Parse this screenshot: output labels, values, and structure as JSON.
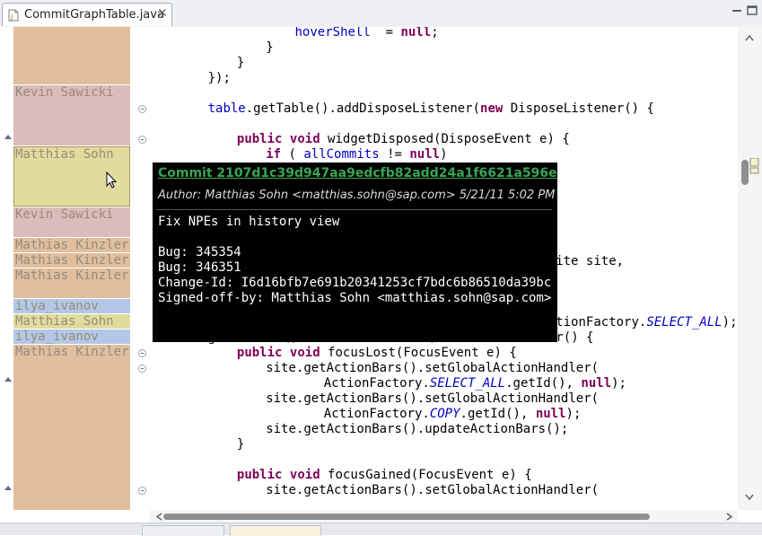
{
  "editor_tab": {
    "title": "CommitGraphTable.java",
    "icon": "java-file-icon",
    "close_icon": "close-icon"
  },
  "window_controls": {
    "minimize_icon": "minimize-icon",
    "maximize_icon": "maximize-icon"
  },
  "blame": {
    "authors": [
      "Kevin Sawicki",
      "Matthias Sohn",
      "Kevin Sawicki",
      "Mathias Kinzler",
      "Mathias Kinzler",
      "Mathias Kinzler",
      "ilya_ivanov",
      "Matthias Sohn",
      "ilya_ivanov",
      "Mathias Kinzler"
    ]
  },
  "code_lines": [
    {
      "indent": 5,
      "tokens": [
        [
          "fd",
          "hoverShell"
        ],
        [
          "",
          "  = "
        ],
        [
          "kw",
          "null"
        ],
        [
          "",
          ";"
        ]
      ]
    },
    {
      "indent": 4,
      "tokens": [
        [
          "",
          "}"
        ]
      ]
    },
    {
      "indent": 3,
      "tokens": [
        [
          "",
          "}"
        ]
      ]
    },
    {
      "indent": 2,
      "tokens": [
        [
          "",
          "});"
        ]
      ]
    },
    {
      "indent": 0,
      "tokens": []
    },
    {
      "indent": 2,
      "tokens": [
        [
          "fd",
          "table"
        ],
        [
          "",
          ".getTable().addDisposeListener("
        ],
        [
          "kw",
          "new"
        ],
        [
          "",
          " DisposeListener() {"
        ]
      ]
    },
    {
      "indent": 0,
      "tokens": []
    },
    {
      "indent": 3,
      "tokens": [
        [
          "kw",
          "public"
        ],
        [
          "",
          " "
        ],
        [
          "kw",
          "void"
        ],
        [
          "",
          " widgetDisposed(DisposeEvent e) {"
        ]
      ]
    },
    {
      "indent": 4,
      "tokens": [
        [
          "kw",
          "if"
        ],
        [
          "",
          " ( "
        ],
        [
          "fd",
          "allCommits"
        ],
        [
          "",
          " != "
        ],
        [
          "kw",
          "null"
        ],
        [
          "",
          ")"
        ]
      ]
    },
    {
      "indent": 0,
      "tokens": []
    },
    {
      "indent": 0,
      "tokens": []
    },
    {
      "indent": 0,
      "tokens": []
    },
    {
      "indent": 0,
      "tokens": []
    },
    {
      "indent": 0,
      "tokens": []
    },
    {
      "indent": 0,
      "tokens": []
    },
    {
      "indent": 14,
      "tokens": [
        [
          "",
          "ite site,"
        ]
      ]
    },
    {
      "indent": 0,
      "tokens": []
    },
    {
      "indent": 0,
      "tokens": []
    },
    {
      "indent": 0,
      "tokens": []
    },
    {
      "indent": 14,
      "tokens": [
        [
          "",
          "tionFactory."
        ],
        [
          "fdi",
          "SELECT_ALL"
        ],
        [
          "",
          ");"
        ]
      ]
    },
    {
      "indent": 2,
      "tokens": [
        [
          "",
          "getControl().addFocusListener("
        ],
        [
          "kw",
          "new"
        ],
        [
          "",
          " FocusListener() {"
        ]
      ]
    },
    {
      "indent": 3,
      "tokens": [
        [
          "kw",
          "public"
        ],
        [
          "",
          " "
        ],
        [
          "kw",
          "void"
        ],
        [
          "",
          " focusLost(FocusEvent e) {"
        ]
      ]
    },
    {
      "indent": 4,
      "tokens": [
        [
          "",
          "site.getActionBars().setGlobalActionHandler("
        ]
      ]
    },
    {
      "indent": 6,
      "tokens": [
        [
          "",
          "ActionFactory."
        ],
        [
          "fdi",
          "SELECT_ALL"
        ],
        [
          "",
          ".getId(), "
        ],
        [
          "kw",
          "null"
        ],
        [
          "",
          ");"
        ]
      ]
    },
    {
      "indent": 4,
      "tokens": [
        [
          "",
          "site.getActionBars().setGlobalActionHandler("
        ]
      ]
    },
    {
      "indent": 6,
      "tokens": [
        [
          "",
          "ActionFactory."
        ],
        [
          "fdi",
          "COPY"
        ],
        [
          "",
          ".getId(), "
        ],
        [
          "kw",
          "null"
        ],
        [
          "",
          ");"
        ]
      ]
    },
    {
      "indent": 4,
      "tokens": [
        [
          "",
          "site.getActionBars().updateActionBars();"
        ]
      ]
    },
    {
      "indent": 3,
      "tokens": [
        [
          "",
          "}"
        ]
      ]
    },
    {
      "indent": 0,
      "tokens": []
    },
    {
      "indent": 3,
      "tokens": [
        [
          "kw",
          "public"
        ],
        [
          "",
          " "
        ],
        [
          "kw",
          "void"
        ],
        [
          "",
          " focusGained(FocusEvent e) {"
        ]
      ]
    },
    {
      "indent": 4,
      "tokens": [
        [
          "",
          "site.getActionBars().setGlobalActionHandler("
        ]
      ]
    }
  ],
  "popup": {
    "title": "Commit 2107d1c39d947aa9edcfb82add24a1f6621a596e",
    "author": "Author: Matthias Sohn <matthias.sohn@sap.com> 5/21/11 5:02 PM",
    "message": "Fix NPEs in history view\n\nBug: 345354\nBug: 346351\nChange-Id: I6d16bfb7e691b20341253cf7bdc6b86510da39bc\nSigned-off-by: Matthias Sohn <matthias.sohn@sap.com>"
  },
  "colors": {
    "keyword": "#7f0055",
    "field": "#0000c0",
    "blame_tan": "#dfbf9e",
    "blame_pink": "#dcbbbb",
    "blame_yellow": "#e1dc9e",
    "blame_blue": "#b3c8e6",
    "popup_link": "#3aa554"
  }
}
